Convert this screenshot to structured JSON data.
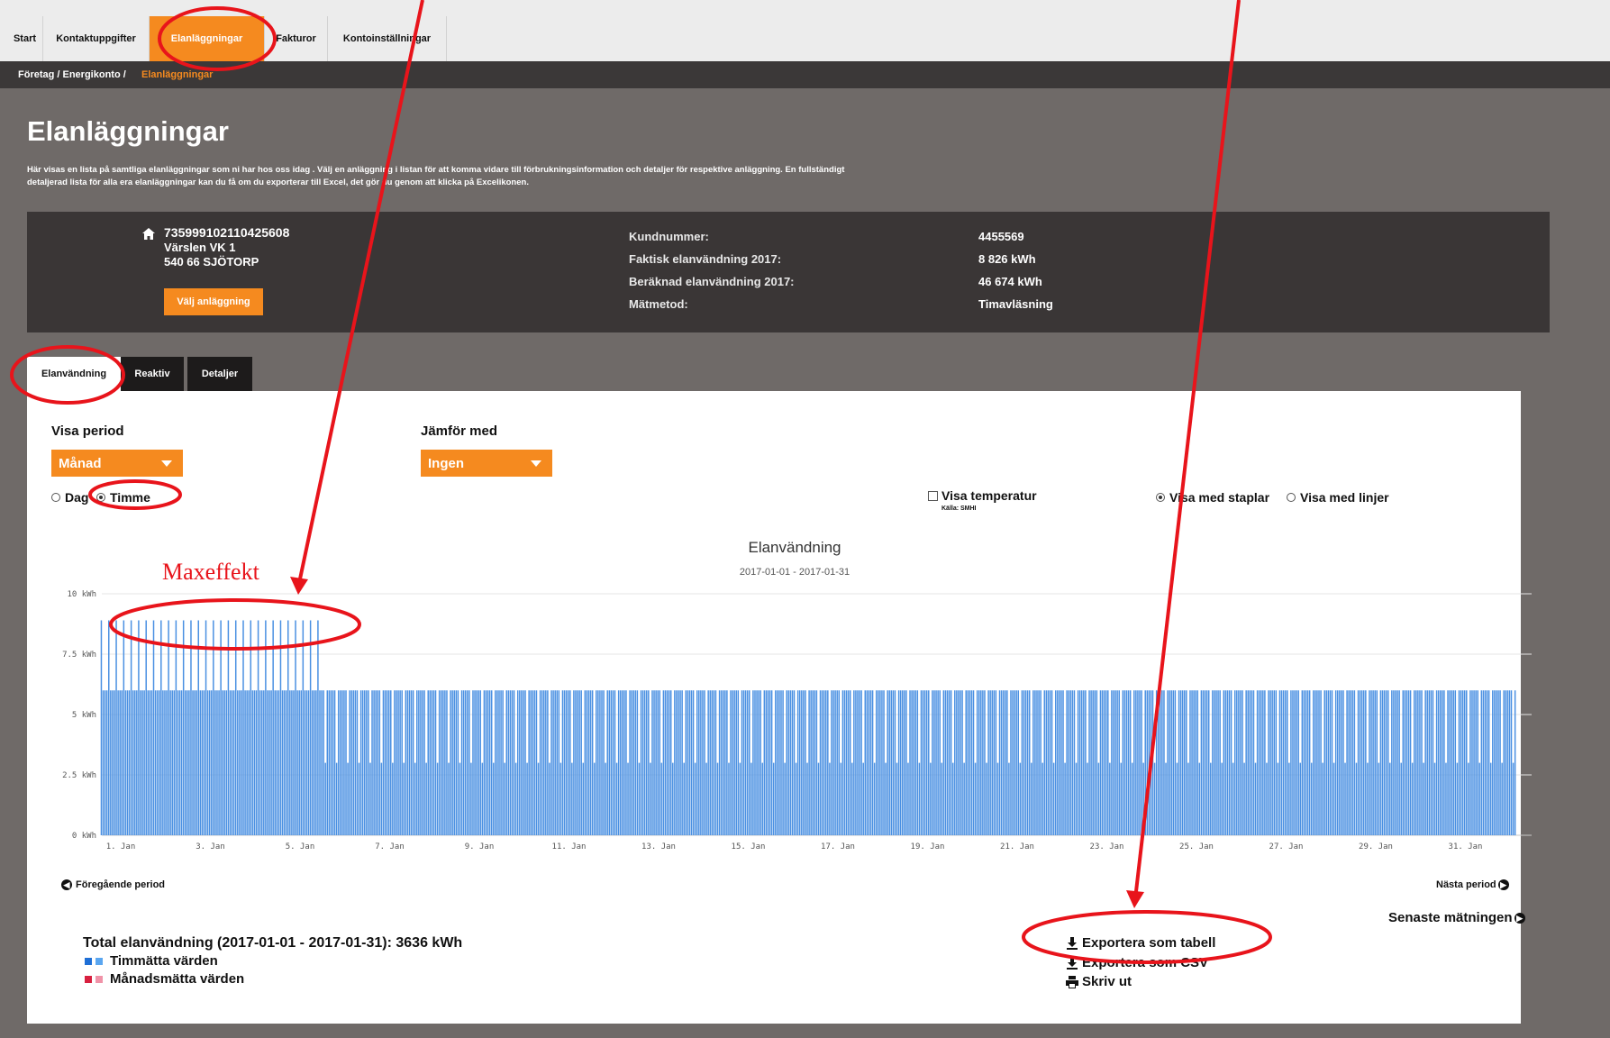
{
  "nav": {
    "tabs": [
      "Start",
      "Kontaktuppgifter",
      "Elanläggningar",
      "Fakturor",
      "Kontoinställningar"
    ],
    "active_index": 2,
    "accent": "#f58a1f"
  },
  "breadcrumb": {
    "path": "Företag / Energikonto / ",
    "current": "Elanläggningar"
  },
  "page": {
    "title": "Elanläggningar",
    "intro_line1": "Här visas en lista på samtliga elanläggningar som ni har hos oss idag . Välj en anläggning i listan för att komma vidare till förbrukningsinformation och detaljer för respektive anläggning. En fullständigt",
    "intro_line2": "detaljerad lista för alla era elanläggningar kan du få om du exporterar till Excel, det gör du genom att klicka på Excelikonen."
  },
  "facility": {
    "id": "735999102110425608",
    "street": "Värslen VK 1",
    "city": "540 66 SJÖTORP",
    "select_button": "Välj anläggning",
    "home_icon": "home-icon",
    "fields": [
      {
        "label": "Kundnummer:",
        "value": "4455569"
      },
      {
        "label": "Faktisk elanvändning 2017:",
        "value": "8 826 kWh"
      },
      {
        "label": "Beräknad elanvändning 2017:",
        "value": "46 674 kWh"
      },
      {
        "label": "Mätmetod:",
        "value": "Timavläsning"
      }
    ]
  },
  "content_tabs": [
    "Elanvändning",
    "Reaktiv",
    "Detaljer"
  ],
  "controls": {
    "period_label": "Visa period",
    "period_value": "Månad",
    "compare_label": "Jämför med",
    "compare_value": "Ingen",
    "resolution_options": [
      "Dag",
      "Timme"
    ],
    "resolution_selected": "Timme",
    "temperature_label": "Visa temperatur",
    "temperature_source": "Källa: SMHI",
    "view_options": [
      "Visa med staplar",
      "Visa med linjer"
    ],
    "view_selected": "Visa med staplar"
  },
  "chart_data": {
    "type": "bar",
    "title": "Elanvändning",
    "subtitle": "2017-01-01 - 2017-01-31",
    "y_unit": "kWh",
    "ylim": [
      0,
      10
    ],
    "y_ticks": [
      "10 kWh",
      "7.5 kWh",
      "5 kWh",
      "2.5 kWh",
      "0 kWh"
    ],
    "x_ticks": [
      "1. Jan",
      "3. Jan",
      "5. Jan",
      "7. Jan",
      "9. Jan",
      "11. Jan",
      "13. Jan",
      "15. Jan",
      "17. Jan",
      "19. Jan",
      "21. Jan",
      "23. Jan",
      "25. Jan",
      "27. Jan",
      "29. Jan",
      "31. Jan"
    ],
    "grid": true,
    "color": "#4a90e2",
    "pattern_days": [
      {
        "days": "1-5",
        "high": 8.9,
        "base": 6.0
      },
      {
        "days": "6-31",
        "high": 6.0,
        "base": 3.0
      }
    ]
  },
  "nav_links": {
    "previous": "Föregående period",
    "next": "Nästa period",
    "latest": "Senaste mätningen"
  },
  "summary": {
    "total": "Total elanvändning (2017-01-01 - 2017-01-31): 3636 kWh",
    "legend": [
      {
        "label": "Timmätta värden",
        "colors": [
          "#1f6fd6",
          "#5aa6f0"
        ]
      },
      {
        "label": "Månadsmätta värden",
        "colors": [
          "#d8203f",
          "#f093a8"
        ]
      }
    ]
  },
  "exports": {
    "table": "Exportera som tabell",
    "csv": "Exportera som CSV",
    "print": "Skriv ut"
  },
  "annotation": {
    "label": "Maxeffekt",
    "color": "#e8141b"
  }
}
